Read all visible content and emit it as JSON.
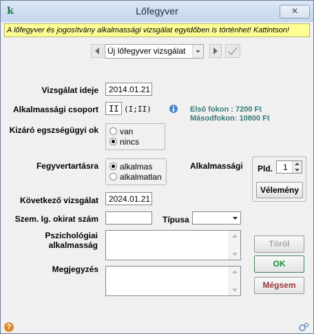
{
  "window": {
    "title": "Lőfegyver",
    "app_icon_glyph": "k",
    "close_glyph": "✕"
  },
  "alert": {
    "text": "A lőfegyver és jogosítvány alkalmassági vizsgálat egyidőben is történhet! Kattintson!",
    "background": "#ffff96"
  },
  "nav": {
    "exam_type_value": "Új lőfegyver vizsgálat"
  },
  "form": {
    "exam_date_label": "Vizsgálat ideje",
    "exam_date_value": "2014.01.21",
    "fitness_group_label": "Alkalmassági csoport",
    "fitness_group_value": "II",
    "fitness_group_options": "(I;II)",
    "fee_first_label": "Első fokon :",
    "fee_first_value": "7200 Ft",
    "fee_second_label": "Másodfokon:",
    "fee_second_value": "10800 Ft",
    "exclusion_label": "Kizáró egszségügyi ok",
    "exclusion_options": [
      "van",
      "nincs"
    ],
    "exclusion_selected": "nincs",
    "weapon_label": "Fegyvertartásra",
    "weapon_options": [
      "alkalmas",
      "alkalmatlan"
    ],
    "weapon_selected": "alkalmas",
    "fitness_label": "Alkalmassági",
    "copies_label": "Pld.",
    "copies_value": "1",
    "opinion_button": "Vélemény",
    "next_exam_label": "Következő vizsgálat",
    "next_exam_value": "2024.01.21",
    "id_doc_number_label": "Szem. Ig. okirat szám",
    "id_doc_number_value": "",
    "type_label": "Típusa",
    "type_value": "",
    "psych_label_line1": "Pszichológiai",
    "psych_label_line2": "alkalmasság",
    "note_label": "Megjegyzés"
  },
  "buttons": {
    "delete": "Töröl",
    "ok": "OK",
    "cancel": "Mégsem"
  },
  "colors": {
    "ok_text": "#1a8a3a",
    "cancel_text": "#9a3a3a",
    "info_text": "#3a7a7a",
    "title_bar": "#c4d7ee"
  },
  "icons": {
    "help": "help-icon",
    "info": "info-icon",
    "status_right": "settings-icon"
  }
}
